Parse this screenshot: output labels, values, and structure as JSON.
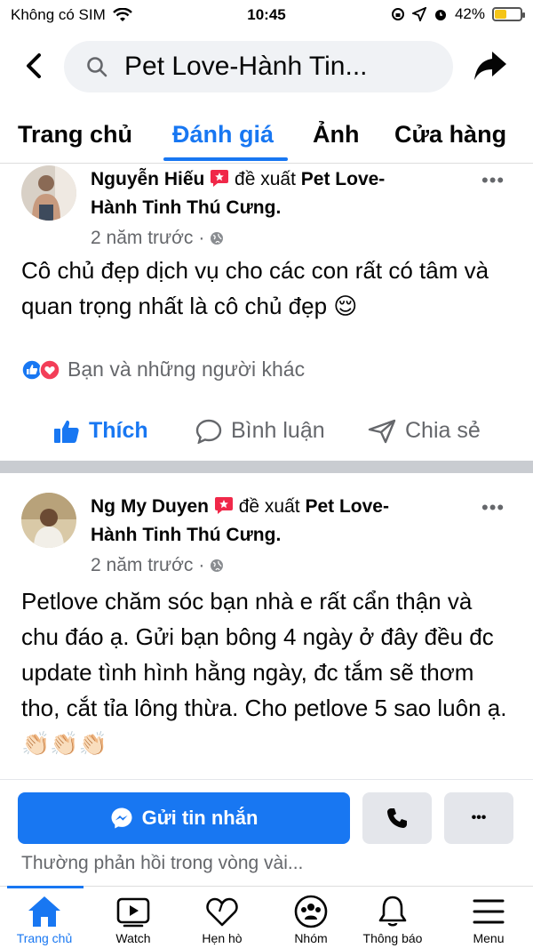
{
  "status_bar": {
    "carrier": "Không có SIM",
    "time": "10:45",
    "battery": "42%",
    "battery_level": 0.42
  },
  "header": {
    "search_text": "Pet Love-Hành Tin...",
    "back_icon": "chevron-left-icon",
    "share_icon": "share-arrow-icon"
  },
  "tabs": [
    {
      "label": "Trang chủ",
      "active": false
    },
    {
      "label": "Đánh giá",
      "active": true
    },
    {
      "label": "Ảnh",
      "active": false
    },
    {
      "label": "Cửa hàng",
      "active": false
    }
  ],
  "posts": [
    {
      "author": "Nguyễn Hiếu",
      "verb": "đề xuất",
      "page": "Pet Love-",
      "page_line2": "Hành Tinh Thú Cưng.",
      "time": "2 năm trước",
      "privacy_sep": "·",
      "text": "Cô chủ đẹp dịch vụ cho các con rất có tâm và quan trọng nhất là cô chủ đẹp 😌",
      "reactions": "Bạn và những người khác",
      "more": "•••"
    },
    {
      "author": "Ng My Duyen",
      "verb": "đề xuất",
      "page": "Pet Love-",
      "page_line2": "Hành Tinh Thú Cưng.",
      "time": "2 năm trước",
      "privacy_sep": "·",
      "text": "Petlove chăm sóc bạn nhà e rất cẩn thận và chu đáo ạ. Gửi bạn bông 4 ngày ở đây đều đc update tình hình hằng ngày, đc tắm sẽ thơm tho, cắt tỉa lông thừa. Cho petlove 5 sao luôn ạ. 👏🏻👏🏻👏🏻",
      "more": "•••"
    }
  ],
  "actions": {
    "like": "Thích",
    "comment": "Bình luận",
    "share": "Chia sẻ"
  },
  "cta": {
    "message_label": "Gửi tin nhắn",
    "more_label": "•••",
    "reply_note": "Thường phản hồi trong vòng vài..."
  },
  "bottom_nav": [
    {
      "label": "Trang chủ",
      "icon": "home-icon",
      "active": true
    },
    {
      "label": "Watch",
      "icon": "video-icon",
      "active": false
    },
    {
      "label": "Hẹn hò",
      "icon": "heart-outline-icon",
      "active": false
    },
    {
      "label": "Nhóm",
      "icon": "groups-icon",
      "active": false
    },
    {
      "label": "Thông báo",
      "icon": "bell-icon",
      "active": false
    },
    {
      "label": "Menu",
      "icon": "hamburger-icon",
      "active": false
    }
  ],
  "colors": {
    "accent": "#1877f2",
    "secondary_text": "#65676b",
    "divider": "#c9ccd1",
    "badge_red": "#f02849"
  }
}
